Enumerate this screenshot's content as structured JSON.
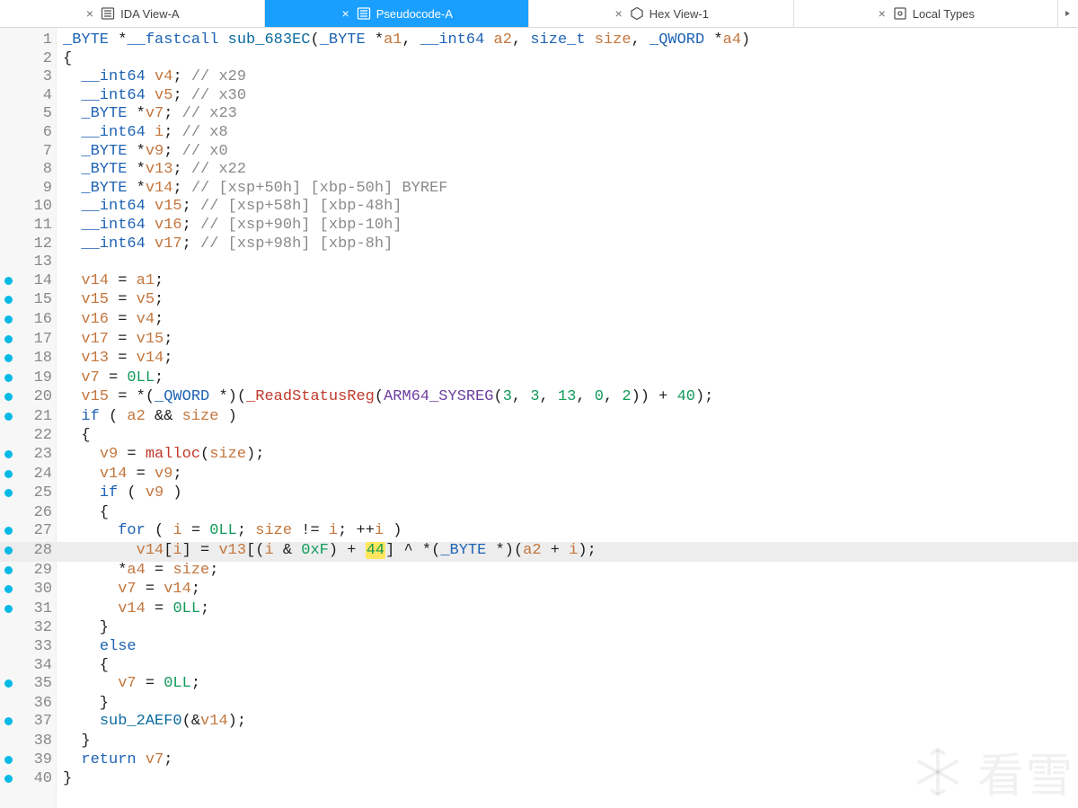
{
  "tabs": [
    {
      "label": "IDA View-A",
      "icon": "list",
      "active": false
    },
    {
      "label": "Pseudocode-A",
      "icon": "list",
      "active": true
    },
    {
      "label": "Hex View-1",
      "icon": "hex",
      "active": false
    },
    {
      "label": "Local Types",
      "icon": "types",
      "active": false
    }
  ],
  "watermark_text": "看雪",
  "highlight_token": "44",
  "highlighted_line": 28,
  "code_lines": [
    {
      "n": 1,
      "bp": false,
      "tokens": [
        [
          "type",
          "_BYTE"
        ],
        [
          "op",
          " *"
        ],
        [
          "kw",
          "__fastcall"
        ],
        [
          "op",
          " "
        ],
        [
          "func",
          "sub_683EC"
        ],
        [
          "op",
          "("
        ],
        [
          "type",
          "_BYTE"
        ],
        [
          "op",
          " *"
        ],
        [
          "var",
          "a1"
        ],
        [
          "op",
          ", "
        ],
        [
          "type",
          "__int64"
        ],
        [
          "op",
          " "
        ],
        [
          "var",
          "a2"
        ],
        [
          "op",
          ", "
        ],
        [
          "type",
          "size_t"
        ],
        [
          "op",
          " "
        ],
        [
          "var",
          "size"
        ],
        [
          "op",
          ", "
        ],
        [
          "type",
          "_QWORD"
        ],
        [
          "op",
          " *"
        ],
        [
          "var",
          "a4"
        ],
        [
          "op",
          ")"
        ]
      ]
    },
    {
      "n": 2,
      "bp": false,
      "tokens": [
        [
          "op",
          "{"
        ]
      ]
    },
    {
      "n": 3,
      "bp": false,
      "tokens": [
        [
          "op",
          "  "
        ],
        [
          "type",
          "__int64"
        ],
        [
          "op",
          " "
        ],
        [
          "var",
          "v4"
        ],
        [
          "op",
          "; "
        ],
        [
          "comm",
          "// x29"
        ]
      ]
    },
    {
      "n": 4,
      "bp": false,
      "tokens": [
        [
          "op",
          "  "
        ],
        [
          "type",
          "__int64"
        ],
        [
          "op",
          " "
        ],
        [
          "var",
          "v5"
        ],
        [
          "op",
          "; "
        ],
        [
          "comm",
          "// x30"
        ]
      ]
    },
    {
      "n": 5,
      "bp": false,
      "tokens": [
        [
          "op",
          "  "
        ],
        [
          "type",
          "_BYTE"
        ],
        [
          "op",
          " *"
        ],
        [
          "var",
          "v7"
        ],
        [
          "op",
          "; "
        ],
        [
          "comm",
          "// x23"
        ]
      ]
    },
    {
      "n": 6,
      "bp": false,
      "tokens": [
        [
          "op",
          "  "
        ],
        [
          "type",
          "__int64"
        ],
        [
          "op",
          " "
        ],
        [
          "var",
          "i"
        ],
        [
          "op",
          "; "
        ],
        [
          "comm",
          "// x8"
        ]
      ]
    },
    {
      "n": 7,
      "bp": false,
      "tokens": [
        [
          "op",
          "  "
        ],
        [
          "type",
          "_BYTE"
        ],
        [
          "op",
          " *"
        ],
        [
          "var",
          "v9"
        ],
        [
          "op",
          "; "
        ],
        [
          "comm",
          "// x0"
        ]
      ]
    },
    {
      "n": 8,
      "bp": false,
      "tokens": [
        [
          "op",
          "  "
        ],
        [
          "type",
          "_BYTE"
        ],
        [
          "op",
          " *"
        ],
        [
          "var",
          "v13"
        ],
        [
          "op",
          "; "
        ],
        [
          "comm",
          "// x22"
        ]
      ]
    },
    {
      "n": 9,
      "bp": false,
      "tokens": [
        [
          "op",
          "  "
        ],
        [
          "type",
          "_BYTE"
        ],
        [
          "op",
          " *"
        ],
        [
          "var",
          "v14"
        ],
        [
          "op",
          "; "
        ],
        [
          "comm",
          "// [xsp+50h] [xbp-50h] BYREF"
        ]
      ]
    },
    {
      "n": 10,
      "bp": false,
      "tokens": [
        [
          "op",
          "  "
        ],
        [
          "type",
          "__int64"
        ],
        [
          "op",
          " "
        ],
        [
          "var",
          "v15"
        ],
        [
          "op",
          "; "
        ],
        [
          "comm",
          "// [xsp+58h] [xbp-48h]"
        ]
      ]
    },
    {
      "n": 11,
      "bp": false,
      "tokens": [
        [
          "op",
          "  "
        ],
        [
          "type",
          "__int64"
        ],
        [
          "op",
          " "
        ],
        [
          "var",
          "v16"
        ],
        [
          "op",
          "; "
        ],
        [
          "comm",
          "// [xsp+90h] [xbp-10h]"
        ]
      ]
    },
    {
      "n": 12,
      "bp": false,
      "tokens": [
        [
          "op",
          "  "
        ],
        [
          "type",
          "__int64"
        ],
        [
          "op",
          " "
        ],
        [
          "var",
          "v17"
        ],
        [
          "op",
          "; "
        ],
        [
          "comm",
          "// [xsp+98h] [xbp-8h]"
        ]
      ]
    },
    {
      "n": 13,
      "bp": false,
      "tokens": [
        [
          "op",
          ""
        ]
      ]
    },
    {
      "n": 14,
      "bp": true,
      "tokens": [
        [
          "op",
          "  "
        ],
        [
          "var",
          "v14"
        ],
        [
          "op",
          " = "
        ],
        [
          "var",
          "a1"
        ],
        [
          "op",
          ";"
        ]
      ]
    },
    {
      "n": 15,
      "bp": true,
      "tokens": [
        [
          "op",
          "  "
        ],
        [
          "var",
          "v15"
        ],
        [
          "op",
          " = "
        ],
        [
          "var",
          "v5"
        ],
        [
          "op",
          ";"
        ]
      ]
    },
    {
      "n": 16,
      "bp": true,
      "tokens": [
        [
          "op",
          "  "
        ],
        [
          "var",
          "v16"
        ],
        [
          "op",
          " = "
        ],
        [
          "var",
          "v4"
        ],
        [
          "op",
          ";"
        ]
      ]
    },
    {
      "n": 17,
      "bp": true,
      "tokens": [
        [
          "op",
          "  "
        ],
        [
          "var",
          "v17"
        ],
        [
          "op",
          " = "
        ],
        [
          "var",
          "v15"
        ],
        [
          "op",
          ";"
        ]
      ]
    },
    {
      "n": 18,
      "bp": true,
      "tokens": [
        [
          "op",
          "  "
        ],
        [
          "var",
          "v13"
        ],
        [
          "op",
          " = "
        ],
        [
          "var",
          "v14"
        ],
        [
          "op",
          ";"
        ]
      ]
    },
    {
      "n": 19,
      "bp": true,
      "tokens": [
        [
          "op",
          "  "
        ],
        [
          "var",
          "v7"
        ],
        [
          "op",
          " = "
        ],
        [
          "num",
          "0LL"
        ],
        [
          "op",
          ";"
        ]
      ]
    },
    {
      "n": 20,
      "bp": true,
      "tokens": [
        [
          "op",
          "  "
        ],
        [
          "var",
          "v15"
        ],
        [
          "op",
          " = *("
        ],
        [
          "type",
          "_QWORD"
        ],
        [
          "op",
          " *)("
        ],
        [
          "call",
          "_ReadStatusReg"
        ],
        [
          "op",
          "("
        ],
        [
          "macro",
          "ARM64_SYSREG"
        ],
        [
          "op",
          "("
        ],
        [
          "num",
          "3"
        ],
        [
          "op",
          ", "
        ],
        [
          "num",
          "3"
        ],
        [
          "op",
          ", "
        ],
        [
          "num",
          "13"
        ],
        [
          "op",
          ", "
        ],
        [
          "num",
          "0"
        ],
        [
          "op",
          ", "
        ],
        [
          "num",
          "2"
        ],
        [
          "op",
          ")) + "
        ],
        [
          "num",
          "40"
        ],
        [
          "op",
          ");"
        ]
      ]
    },
    {
      "n": 21,
      "bp": true,
      "tokens": [
        [
          "op",
          "  "
        ],
        [
          "kw",
          "if"
        ],
        [
          "op",
          " ( "
        ],
        [
          "var",
          "a2"
        ],
        [
          "op",
          " && "
        ],
        [
          "var",
          "size"
        ],
        [
          "op",
          " )"
        ]
      ]
    },
    {
      "n": 22,
      "bp": false,
      "tokens": [
        [
          "op",
          "  {"
        ]
      ]
    },
    {
      "n": 23,
      "bp": true,
      "tokens": [
        [
          "op",
          "    "
        ],
        [
          "var",
          "v9"
        ],
        [
          "op",
          " = "
        ],
        [
          "call",
          "malloc"
        ],
        [
          "op",
          "("
        ],
        [
          "var",
          "size"
        ],
        [
          "op",
          ");"
        ]
      ]
    },
    {
      "n": 24,
      "bp": true,
      "tokens": [
        [
          "op",
          "    "
        ],
        [
          "var",
          "v14"
        ],
        [
          "op",
          " = "
        ],
        [
          "var",
          "v9"
        ],
        [
          "op",
          ";"
        ]
      ]
    },
    {
      "n": 25,
      "bp": true,
      "tokens": [
        [
          "op",
          "    "
        ],
        [
          "kw",
          "if"
        ],
        [
          "op",
          " ( "
        ],
        [
          "var",
          "v9"
        ],
        [
          "op",
          " )"
        ]
      ]
    },
    {
      "n": 26,
      "bp": false,
      "tokens": [
        [
          "op",
          "    {"
        ]
      ]
    },
    {
      "n": 27,
      "bp": true,
      "tokens": [
        [
          "op",
          "      "
        ],
        [
          "kw",
          "for"
        ],
        [
          "op",
          " ( "
        ],
        [
          "var",
          "i"
        ],
        [
          "op",
          " = "
        ],
        [
          "num",
          "0LL"
        ],
        [
          "op",
          "; "
        ],
        [
          "var",
          "size"
        ],
        [
          "op",
          " != "
        ],
        [
          "var",
          "i"
        ],
        [
          "op",
          "; ++"
        ],
        [
          "var",
          "i"
        ],
        [
          "op",
          " )"
        ]
      ]
    },
    {
      "n": 28,
      "bp": true,
      "tokens": [
        [
          "op",
          "        "
        ],
        [
          "var",
          "v14"
        ],
        [
          "op",
          "["
        ],
        [
          "var",
          "i"
        ],
        [
          "op",
          "] = "
        ],
        [
          "var",
          "v13"
        ],
        [
          "op",
          "[("
        ],
        [
          "var",
          "i"
        ],
        [
          "op",
          " & "
        ],
        [
          "num",
          "0xF"
        ],
        [
          "op",
          ") + "
        ],
        [
          "hl",
          "44"
        ],
        [
          "op",
          "] ^ *("
        ],
        [
          "type",
          "_BYTE"
        ],
        [
          "op",
          " *)("
        ],
        [
          "var",
          "a2"
        ],
        [
          "op",
          " + "
        ],
        [
          "var",
          "i"
        ],
        [
          "op",
          ");"
        ]
      ]
    },
    {
      "n": 29,
      "bp": true,
      "tokens": [
        [
          "op",
          "      *"
        ],
        [
          "var",
          "a4"
        ],
        [
          "op",
          " = "
        ],
        [
          "var",
          "size"
        ],
        [
          "op",
          ";"
        ]
      ]
    },
    {
      "n": 30,
      "bp": true,
      "tokens": [
        [
          "op",
          "      "
        ],
        [
          "var",
          "v7"
        ],
        [
          "op",
          " = "
        ],
        [
          "var",
          "v14"
        ],
        [
          "op",
          ";"
        ]
      ]
    },
    {
      "n": 31,
      "bp": true,
      "tokens": [
        [
          "op",
          "      "
        ],
        [
          "var",
          "v14"
        ],
        [
          "op",
          " = "
        ],
        [
          "num",
          "0LL"
        ],
        [
          "op",
          ";"
        ]
      ]
    },
    {
      "n": 32,
      "bp": false,
      "tokens": [
        [
          "op",
          "    }"
        ]
      ]
    },
    {
      "n": 33,
      "bp": false,
      "tokens": [
        [
          "op",
          "    "
        ],
        [
          "kw",
          "else"
        ]
      ]
    },
    {
      "n": 34,
      "bp": false,
      "tokens": [
        [
          "op",
          "    {"
        ]
      ]
    },
    {
      "n": 35,
      "bp": true,
      "tokens": [
        [
          "op",
          "      "
        ],
        [
          "var",
          "v7"
        ],
        [
          "op",
          " = "
        ],
        [
          "num",
          "0LL"
        ],
        [
          "op",
          ";"
        ]
      ]
    },
    {
      "n": 36,
      "bp": false,
      "tokens": [
        [
          "op",
          "    }"
        ]
      ]
    },
    {
      "n": 37,
      "bp": true,
      "tokens": [
        [
          "op",
          "    "
        ],
        [
          "func",
          "sub_2AEF0"
        ],
        [
          "op",
          "(&"
        ],
        [
          "var",
          "v14"
        ],
        [
          "op",
          ");"
        ]
      ]
    },
    {
      "n": 38,
      "bp": false,
      "tokens": [
        [
          "op",
          "  }"
        ]
      ]
    },
    {
      "n": 39,
      "bp": true,
      "tokens": [
        [
          "op",
          "  "
        ],
        [
          "kw",
          "return"
        ],
        [
          "op",
          " "
        ],
        [
          "var",
          "v7"
        ],
        [
          "op",
          ";"
        ]
      ]
    },
    {
      "n": 40,
      "bp": true,
      "tokens": [
        [
          "op",
          "}"
        ]
      ]
    }
  ]
}
